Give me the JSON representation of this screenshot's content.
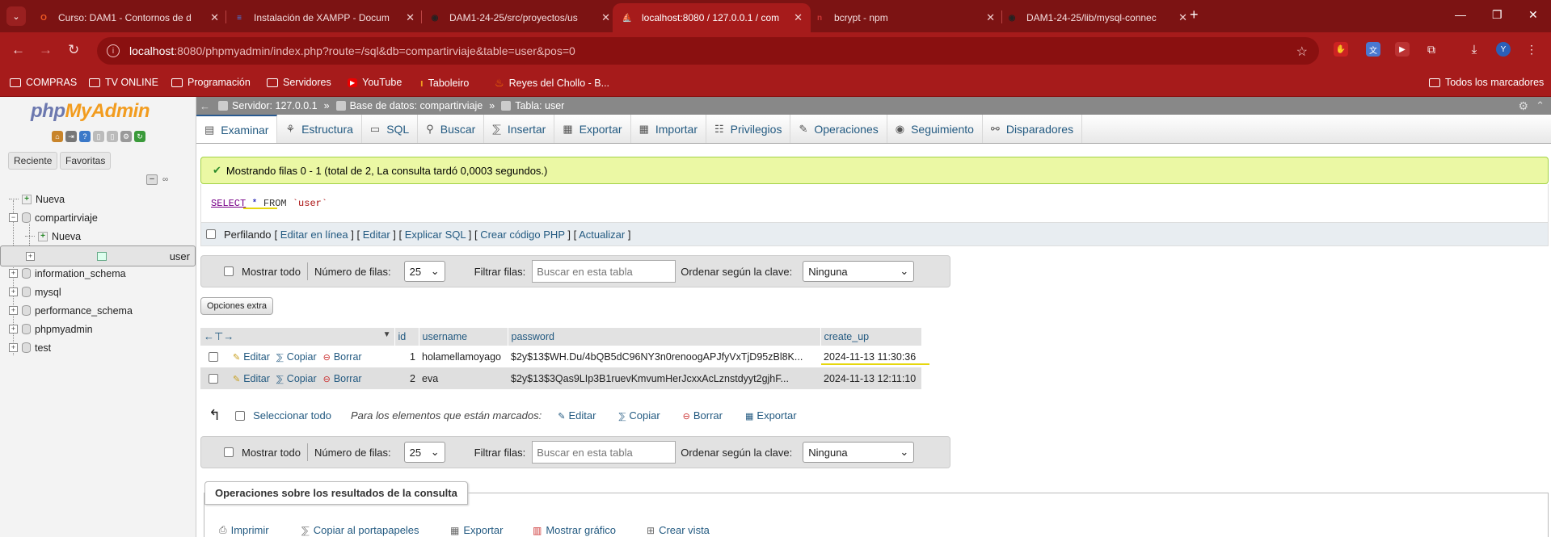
{
  "browser": {
    "tabs": [
      {
        "title": "Curso: DAM1 - Contornos de d",
        "icon": "O",
        "color": "#f15a24"
      },
      {
        "title": "Instalación de XAMPP - Docum",
        "icon": "≡",
        "color": "#4285f4"
      },
      {
        "title": "DAM1-24-25/src/proyectos/us",
        "icon": "◉",
        "color": "#222222"
      },
      {
        "title": "localhost:8080 / 127.0.0.1 / com",
        "icon": "⛵",
        "color": "#f29c1f",
        "active": true
      },
      {
        "title": "bcrypt - npm",
        "icon": "n",
        "color": "#cb3837"
      },
      {
        "title": "DAM1-24-25/lib/mysql-connec",
        "icon": "◉",
        "color": "#222222"
      }
    ],
    "url_host": "localhost",
    "url_path": ":8080/phpmyadmin/index.php?route=/sql&db=compartirviaje&table=user&pos=0",
    "profile_initial": "Y",
    "bookmarks": [
      {
        "label": "COMPRAS",
        "icon": "folder"
      },
      {
        "label": "TV ONLINE",
        "icon": "folder"
      },
      {
        "label": "Programación",
        "icon": "folder"
      },
      {
        "label": "Servidores",
        "icon": "folder"
      },
      {
        "label": "YouTube",
        "icon": "youtube"
      },
      {
        "label": "Taboleiro",
        "icon": "orange"
      },
      {
        "label": "Reyes del Chollo - B...",
        "icon": "flame"
      }
    ],
    "all_bookmarks": "Todos los marcadores"
  },
  "sidebar": {
    "logo_php": "php",
    "logo_my": "MyAdmin",
    "tab_recent": "Reciente",
    "tab_favorites": "Favoritas",
    "tree": [
      {
        "label": "Nueva",
        "level": 0,
        "kind": "new"
      },
      {
        "label": "compartirviaje",
        "level": 0,
        "kind": "db",
        "expanded": true
      },
      {
        "label": "Nueva",
        "level": 1,
        "kind": "new"
      },
      {
        "label": "user",
        "level": 1,
        "kind": "table",
        "selected": true
      },
      {
        "label": "information_schema",
        "level": 0,
        "kind": "db"
      },
      {
        "label": "mysql",
        "level": 0,
        "kind": "db"
      },
      {
        "label": "performance_schema",
        "level": 0,
        "kind": "db"
      },
      {
        "label": "phpmyadmin",
        "level": 0,
        "kind": "db"
      },
      {
        "label": "test",
        "level": 0,
        "kind": "db"
      }
    ]
  },
  "breadcrumb": {
    "server": "Servidor: 127.0.0.1",
    "database": "Base de datos: compartirviaje",
    "table": "Tabla: user"
  },
  "menu": [
    {
      "label": "Examinar",
      "icon": "▤",
      "active": true
    },
    {
      "label": "Estructura",
      "icon": "⚘"
    },
    {
      "label": "SQL",
      "icon": "▭"
    },
    {
      "label": "Buscar",
      "icon": "⚲"
    },
    {
      "label": "Insertar",
      "icon": "⅀"
    },
    {
      "label": "Exportar",
      "icon": "▦"
    },
    {
      "label": "Importar",
      "icon": "▦"
    },
    {
      "label": "Privilegios",
      "icon": "☷"
    },
    {
      "label": "Operaciones",
      "icon": "✎"
    },
    {
      "label": "Seguimiento",
      "icon": "◉"
    },
    {
      "label": "Disparadores",
      "icon": "⚯"
    }
  ],
  "message": "Mostrando filas 0 - 1 (total de 2, La consulta tardó 0,0003 segundos.)",
  "sql": {
    "select": "SELECT",
    "star": "*",
    "from": "FROM",
    "table": "`user`"
  },
  "profiling": {
    "label": "Perfilando",
    "links": [
      "Editar en línea",
      "Editar",
      "Explicar SQL",
      "Crear código PHP",
      "Actualizar"
    ]
  },
  "nav_controls": {
    "show_all": "Mostrar todo",
    "rows_label": "Número de filas:",
    "rows_value": "25",
    "filter_label": "Filtrar filas:",
    "filter_placeholder": "Buscar en esta tabla",
    "sort_label": "Ordenar según la clave:",
    "sort_value": "Ninguna"
  },
  "extra_options": "Opciones extra",
  "table": {
    "headers": [
      "id",
      "username",
      "password",
      "create_up"
    ],
    "actions": {
      "edit": "Editar",
      "copy": "Copiar",
      "delete": "Borrar"
    },
    "rows": [
      {
        "id": "1",
        "username": "holamellamoyago",
        "password": "$2y$13$WH.Du/4bQB5dC96NY3n0renoogAPJfyVxTjD95zBl8K...",
        "create_up": "2024-11-13 11:30:36"
      },
      {
        "id": "2",
        "username": "eva",
        "password": "$2y$13$3Qas9LIp3B1ruevKmvumHerJcxxAcLznstdyyt2gjhF...",
        "create_up": "2024-11-13 12:11:10"
      }
    ]
  },
  "bulk": {
    "select_all": "Seleccionar todo",
    "with_selected": "Para los elementos que están marcados:",
    "edit": "Editar",
    "copy": "Copiar",
    "delete": "Borrar",
    "export": "Exportar"
  },
  "query_ops": {
    "legend": "Operaciones sobre los resultados de la consulta",
    "links": [
      "Imprimir",
      "Copiar al portapapeles",
      "Exportar",
      "Mostrar gráfico",
      "Crear vista"
    ]
  }
}
